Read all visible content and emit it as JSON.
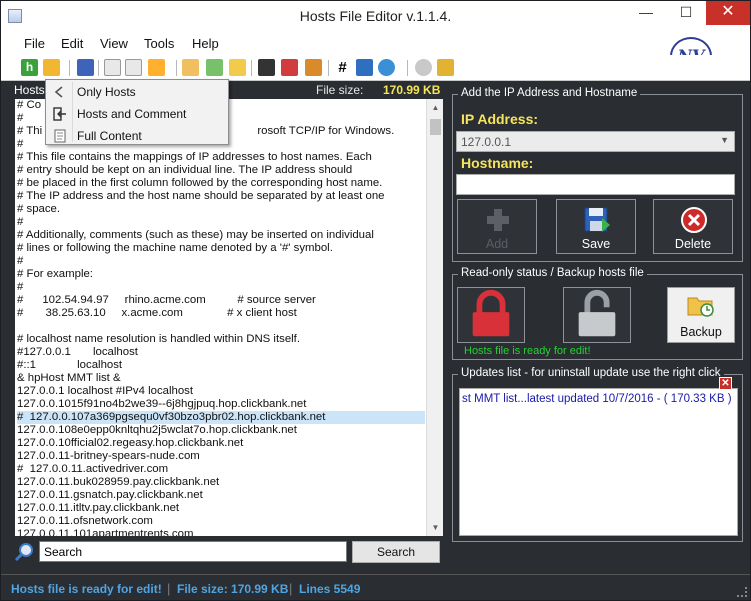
{
  "window": {
    "title": "Hosts File Editor v.1.1.4."
  },
  "menu": {
    "items": [
      "File",
      "Edit",
      "View",
      "Tools",
      "Help"
    ]
  },
  "brand": {
    "logo_text": "NV"
  },
  "dropdown": {
    "items": [
      "Only Hosts",
      "Hosts  and Comment",
      "Full Content"
    ]
  },
  "editor": {
    "header_label": "Hosts",
    "size_label": "File size:",
    "size_value": "170.99 KB",
    "lines": [
      "# Co",
      "#",
      "# Thi                                                                    rosoft TCP/IP for Windows.",
      "#",
      "# This file contains the mappings of IP addresses to host names. Each",
      "# entry should be kept on an individual line. The IP address should",
      "# be placed in the first column followed by the corresponding host name.",
      "# The IP address and the host name should be separated by at least one",
      "# space.",
      "#",
      "# Additionally, comments (such as these) may be inserted on individual",
      "# lines or following the machine name denoted by a '#' symbol.",
      "#",
      "# For example:",
      "#",
      "#      102.54.94.97     rhino.acme.com          # source server",
      "#       38.25.63.10     x.acme.com              # x client host",
      "",
      "# localhost name resolution is handled within DNS itself.",
      "#127.0.0.1       localhost",
      "#::1             localhost",
      "& hpHost MMT list &",
      "127.0.0.1 localhost #IPv4 localhost",
      "127.0.0.1015f91no4b2we39--6j8hgjpuq.hop.clickbank.net",
      "#  127.0.0.107a369pgsequ0vf30bzo3pbr02.hop.clickbank.net",
      "127.0.0.108e0epp0knltqhu2j5wclat7o.hop.clickbank.net",
      "127.0.0.10fficial02.regeasy.hop.clickbank.net",
      "127.0.0.11-britney-spears-nude.com",
      "#  127.0.0.11.activedriver.com",
      "127.0.0.11.buk028959.pay.clickbank.net",
      "127.0.0.11.gsnatch.pay.clickbank.net",
      "127.0.0.11.itltv.pay.clickbank.net",
      "127.0.0.11.ofsnetwork.com",
      "127.0.0.11.101apartmentrents.com"
    ],
    "selected_line_index": 24
  },
  "search": {
    "value": "Search",
    "button_label": "Search"
  },
  "add_panel": {
    "title": "Add the IP Address  and Hostname",
    "ip_label": "IP Address:",
    "ip_value": "127.0.0.1",
    "hostname_label": "Hostname:",
    "hostname_value": "",
    "add_label": "Add",
    "save_label": "Save",
    "delete_label": "Delete"
  },
  "status_panel": {
    "title": "Read-only status / Backup hosts file",
    "backup_label": "Backup",
    "status_text": "Hosts file is ready for edit!"
  },
  "updates": {
    "title": "Updates list -  for uninstall update use the right click",
    "items": [
      "st MMT list...latest updated 10/7/2016 - ( 170.33 KB )"
    ]
  },
  "statusbar": {
    "message": "Hosts file is ready for edit!",
    "file_size": "File size:  170.99 KB",
    "lines": "Lines 5549"
  },
  "colors": {
    "background": "#2a2e33",
    "label_yellow": "#f6e55a",
    "status_blue": "#4ea5e6",
    "status_green": "#24d232",
    "lock_red": "#d8313a"
  }
}
